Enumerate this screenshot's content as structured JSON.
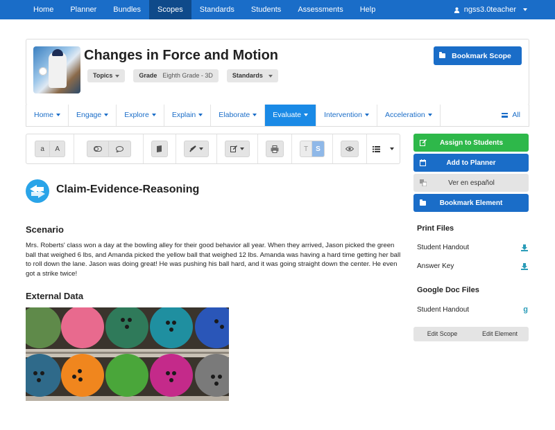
{
  "nav": {
    "items": [
      "Home",
      "Planner",
      "Bundles",
      "Scopes",
      "Standards",
      "Students",
      "Assessments",
      "Help"
    ],
    "active": "Scopes",
    "user": "ngss3.0teacher"
  },
  "header": {
    "title": "Changes in Force and Motion",
    "topics_label": "Topics",
    "grade_label": "Grade",
    "grade_value": "Eighth Grade - 3D",
    "standards_label": "Standards",
    "bookmark_scope": "Bookmark Scope"
  },
  "tabs": {
    "items": [
      "Home",
      "Engage",
      "Explore",
      "Explain",
      "Elaborate",
      "Evaluate",
      "Intervention",
      "Acceleration"
    ],
    "active": "Evaluate",
    "all_label": "All"
  },
  "toolbar": {
    "font_small": "a",
    "font_large": "A",
    "teacher_label": "T",
    "student_label": "S"
  },
  "sidebar": {
    "assign": "Assign to Students",
    "planner": "Add to Planner",
    "spanish": "Ver en español",
    "bookmark_element": "Bookmark Element",
    "print_files_heading": "Print Files",
    "print_files": [
      "Student Handout",
      "Answer Key"
    ],
    "google_heading": "Google Doc Files",
    "google_files": [
      "Student Handout"
    ],
    "edit_scope": "Edit Scope",
    "edit_element": "Edit Element"
  },
  "main": {
    "element_title": "Claim-Evidence-Reasoning",
    "scenario_heading": "Scenario",
    "scenario_text": "Mrs. Roberts' class won a day at the bowling alley for their good behavior all year. When they arrived, Jason picked the green ball that weighed 6 lbs, and Amanda picked the yellow ball that weighed 12 lbs. Amanda was having a hard time getting her ball to roll down the lane. Jason was doing great! He was pushing his ball hard, and it was going straight down the center. He even got a strike twice!",
    "external_heading": "External Data"
  },
  "colors": {
    "primary": "#1a6dc8",
    "active_tab": "#1a8ae6",
    "green": "#2eb84a",
    "teal_icon": "#2a9cb8"
  }
}
